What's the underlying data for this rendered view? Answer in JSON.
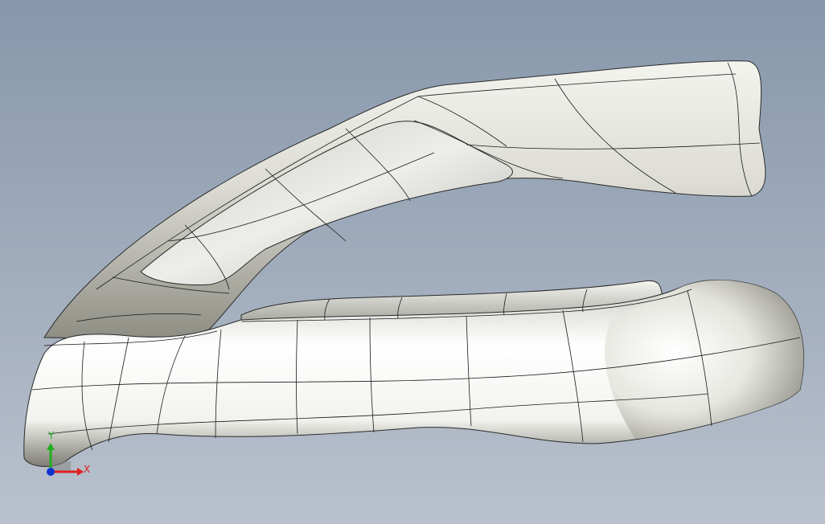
{
  "viewport": {
    "background_top": "#8797ab",
    "background_bottom": "#b9c1cd"
  },
  "model": {
    "surface_color": "#e6e6e0",
    "edge_color": "#1a1a1a"
  },
  "triad": {
    "x_label": "X",
    "y_label": "Y",
    "x_color": "#e02020",
    "y_color": "#20b020",
    "z_color": "#1030d0"
  }
}
